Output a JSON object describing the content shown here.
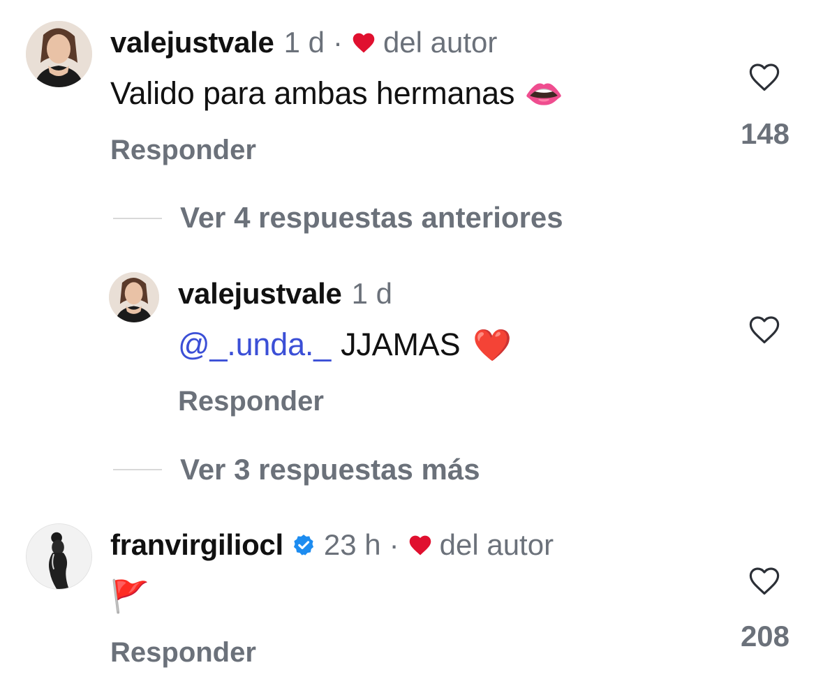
{
  "comments": [
    {
      "username": "valejustvale",
      "time": "1 d",
      "separator": "·",
      "liked_by_author": "del autor",
      "text": "Valido para ambas hermanas",
      "emoji": "👄",
      "reply_label": "Responder",
      "like_count": "148"
    },
    {
      "view_more": "Ver 4 respuestas anteriores"
    },
    {
      "username": "valejustvale",
      "time": "1 d",
      "mention": "@_.unda._",
      "text": "JJAMAS",
      "emoji": "❤️",
      "reply_label": "Responder"
    },
    {
      "view_more": "Ver 3 respuestas más"
    },
    {
      "username": "franvirgiliocl",
      "verified": true,
      "time": "23 h",
      "separator": "·",
      "liked_by_author": "del autor",
      "emoji": "🚩",
      "reply_label": "Responder",
      "like_count": "208"
    }
  ],
  "colors": {
    "author_heart": "#e0102f",
    "mention": "#3b4fd6",
    "verified": "#1d8cf0",
    "muted": "#6b717a"
  }
}
